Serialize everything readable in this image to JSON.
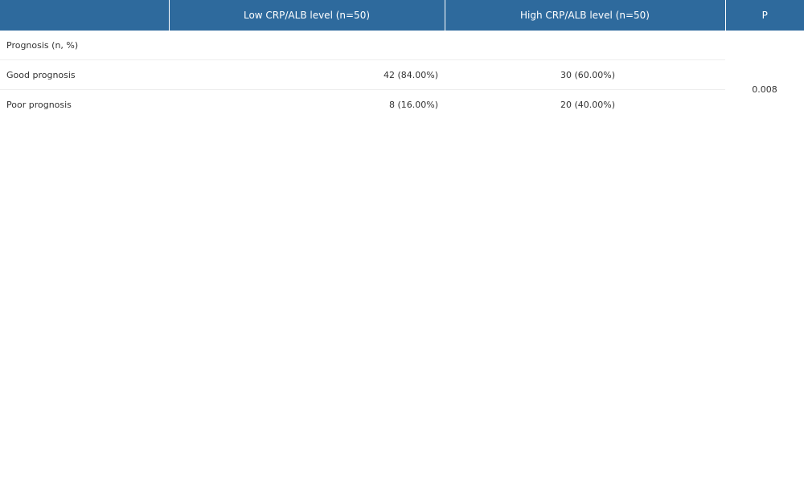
{
  "colors": {
    "header_bg": "#2e6a9d",
    "header_text": "#ffffff"
  },
  "table": {
    "headers": [
      "",
      "Low CRP/ALB level (n=50)",
      "High CRP/ALB level (n=50)",
      "P"
    ],
    "section_label": "Prognosis (n, %)",
    "rows": [
      {
        "label": "Good prognosis",
        "low": "42 (84.00%)",
        "high": "30 (60.00%)"
      },
      {
        "label": "Poor prognosis",
        "low": "8 (16.00%)",
        "high": "20 (40.00%)"
      }
    ],
    "p_value": "0.008"
  }
}
